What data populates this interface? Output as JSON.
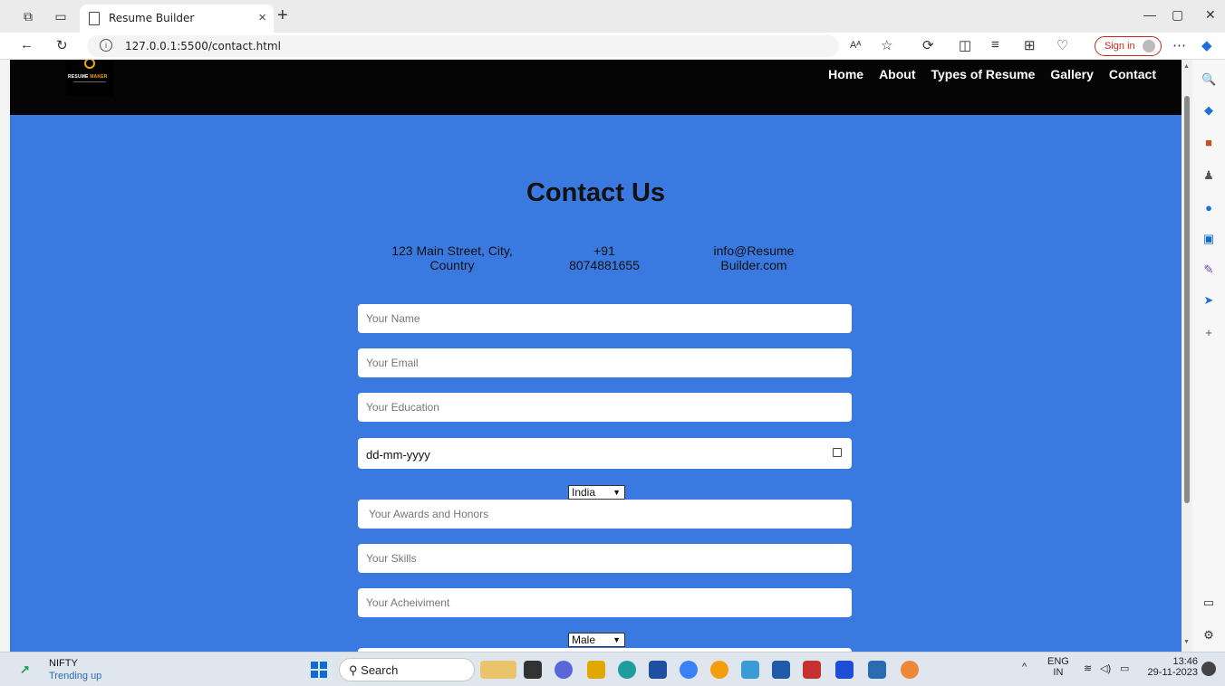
{
  "browser": {
    "tab_title": "Resume Builder",
    "url": "127.0.0.1:5500/contact.html",
    "signin_label": "Sign in"
  },
  "site": {
    "logo_text_1": "RESUME",
    "logo_text_2": "MAKER",
    "nav": [
      "Home",
      "About",
      "Types of Resume",
      "Gallery",
      "Contact"
    ]
  },
  "contact": {
    "heading": "Contact Us",
    "address_line1": "123 Main Street, City,",
    "address_line2": "Country",
    "phone_line1": "+91",
    "phone_line2": "8074881655",
    "email_line1": "info@Resume",
    "email_line2": "Builder.com"
  },
  "form": {
    "name_placeholder": "Your Name",
    "email_placeholder": "Your Email",
    "education_placeholder": "Your Education",
    "date_value": "dd-mm-yyyy",
    "country_selected": "India",
    "awards_placeholder": "Your Awards and Honors",
    "skills_placeholder": "Your Skills",
    "achievement_placeholder": "Your Acheiviment",
    "gender_selected": "Male"
  },
  "taskbar": {
    "widget_title": "NIFTY",
    "widget_sub": "Trending up",
    "search_label": "Search",
    "lang_1": "ENG",
    "lang_2": "IN",
    "time": "13:46",
    "date": "29-11-2023"
  },
  "colors": {
    "page_bg": "#3a7ae0",
    "header_bg": "#050505",
    "logo_accent": "#f2a900"
  }
}
